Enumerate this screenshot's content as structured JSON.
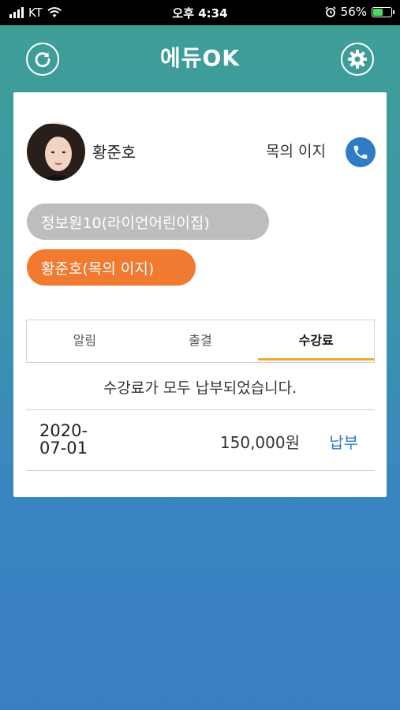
{
  "status_bar": {
    "carrier": "KT",
    "time": "오후 4:34",
    "battery": "56%",
    "battery_level": 0.56
  },
  "header": {
    "title": "에듀OK",
    "refresh_icon": "refresh-icon",
    "settings_icon": "gear-icon",
    "colors": {
      "accent": "#3f9f95",
      "bottom": "#3a7fc4"
    }
  },
  "profile": {
    "student_name": "황준호",
    "class_name": "목의 이지"
  },
  "chips": [
    {
      "label": "정보원10(라이언어린이집)",
      "color": "#bdbdbd"
    },
    {
      "label": "황준호(목의 이지)",
      "color": "#f07a30"
    }
  ],
  "tabs": [
    {
      "label": "알림",
      "active": false
    },
    {
      "label": "출결",
      "active": false
    },
    {
      "label": "수강료",
      "active": true
    }
  ],
  "tuition": {
    "notice": "수강료가 모두 납부되었습니다.",
    "rows": [
      {
        "date_line1": "2020-",
        "date_line2": "07-01",
        "amount": "150,000원",
        "status": "납부"
      }
    ]
  }
}
